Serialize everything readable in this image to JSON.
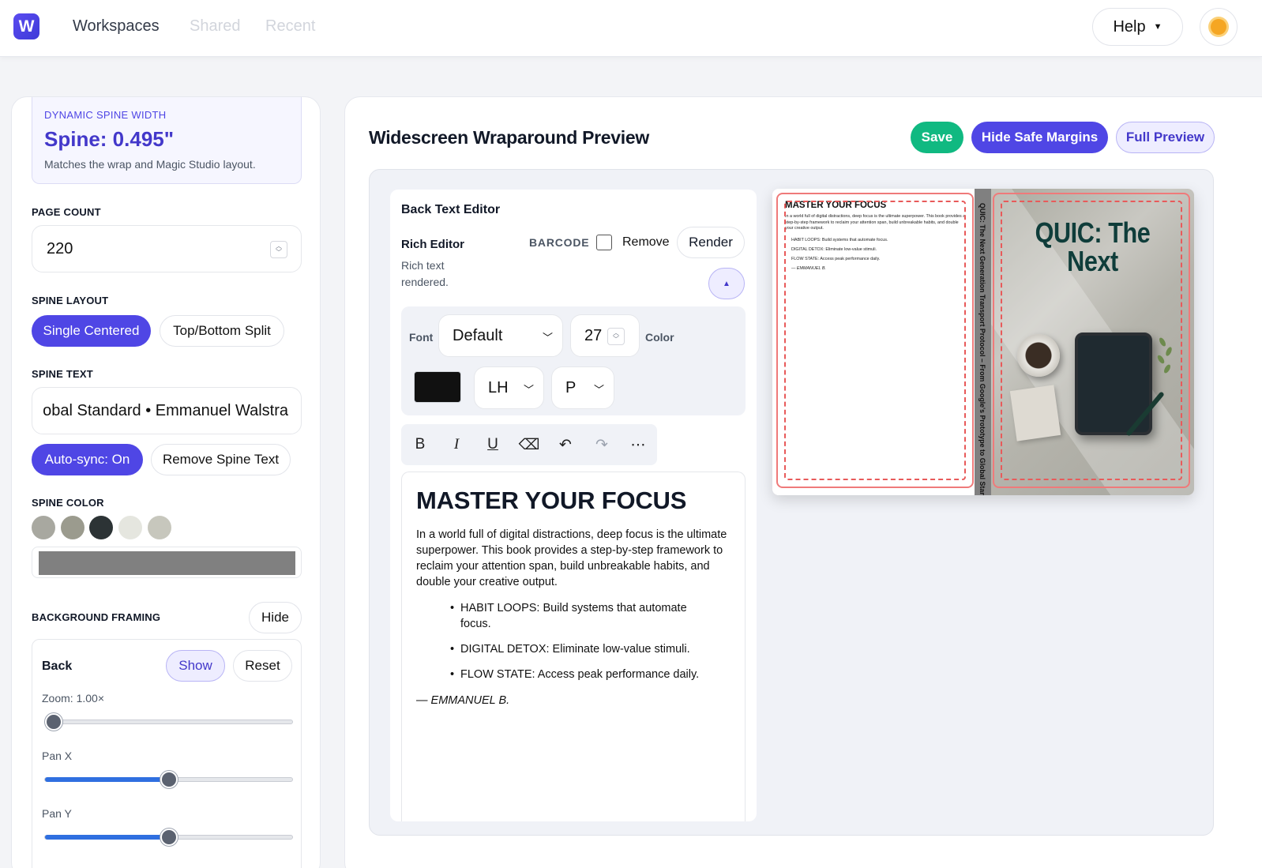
{
  "nav": {
    "logo_letter": "W",
    "links": [
      "Workspaces",
      "Shared",
      "Recent"
    ],
    "help_label": "Help",
    "help_caret": "▼"
  },
  "sidebar": {
    "spine_width": {
      "label": "DYNAMIC SPINE WIDTH",
      "value": "Spine: 0.495\"",
      "note": "Matches the wrap and Magic Studio layout."
    },
    "page_count": {
      "label": "PAGE COUNT",
      "value": "220"
    },
    "spine_layout": {
      "label": "SPINE LAYOUT",
      "options": [
        "Single Centered",
        "Top/Bottom Split"
      ],
      "selected": "Single Centered"
    },
    "spine_text": {
      "label": "SPINE TEXT",
      "value": "obal Standard • Emmanuel Walstra",
      "autosync_label": "Auto-sync: On",
      "remove_label": "Remove Spine Text"
    },
    "spine_color": {
      "label": "SPINE COLOR",
      "swatches": [
        "#a8a8a0",
        "#9b9b8e",
        "#2c3335",
        "#e5e6df",
        "#c7c7bd"
      ],
      "current": "#808080"
    },
    "background_framing": {
      "label": "BACKGROUND FRAMING",
      "hide_label": "Hide",
      "panel_title": "Back",
      "show_label": "Show",
      "reset_label": "Reset",
      "zoom_label": "Zoom: 1.00×",
      "zoom_value": 0.0,
      "panx_label": "Pan X",
      "panx_value": 0.5,
      "pany_label": "Pan Y",
      "pany_value": 0.5
    }
  },
  "main": {
    "title": "Widescreen Wraparound Preview",
    "save_label": "Save",
    "hide_margins_label": "Hide Safe Margins",
    "full_preview_label": "Full Preview",
    "editor": {
      "title": "Back Text Editor",
      "rich_label": "Rich Editor",
      "rich_sub": "Rich text rendered.",
      "barcode_label": "BARCODE",
      "remove_label": "Remove",
      "render_label": "Render",
      "collapse_icon": "▲",
      "font_label": "Font",
      "font_value": "Default",
      "size_value": "27",
      "color_label": "Color",
      "color_value": "#111111",
      "lh_value": "LH",
      "p_value": "P",
      "toolbar": [
        "B",
        "I",
        "U",
        "⌫",
        "↶",
        "↷",
        "⋯"
      ]
    },
    "content": {
      "heading": "MASTER YOUR FOCUS",
      "paragraph": "In a world full of digital distractions, deep focus is the ultimate superpower. This book provides a step-by-step framework to reclaim your attention span, build unbreakable habits, and double your creative output.",
      "bullets": [
        "HABIT LOOPS: Build systems that automate focus.",
        "DIGITAL DETOX: Eliminate low-value stimuli.",
        "FLOW STATE: Access peak performance daily."
      ],
      "signature": "— EMMANUEL B."
    },
    "cover": {
      "spine_text": "QUIC: The Next Generation Transport Protocol – From Google's Prototype to Global Standa",
      "front_title": "QUIC: The Next"
    }
  }
}
